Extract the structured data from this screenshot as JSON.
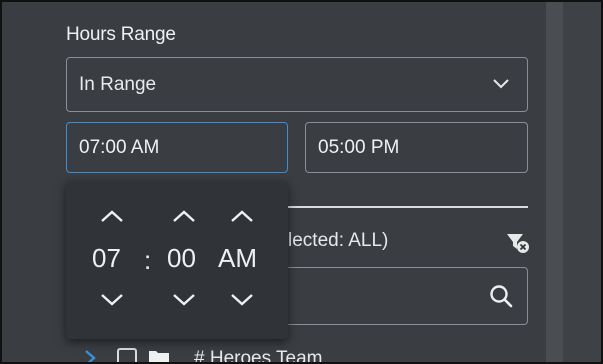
{
  "hours_range": {
    "label": "Hours Range",
    "mode_value": "In Range",
    "from_value": "07:00 AM",
    "to_value": "05:00 PM"
  },
  "time_picker": {
    "hour": "07",
    "separator": ":",
    "minute": "00",
    "meridiem": "AM"
  },
  "selection": {
    "partial_label": "lected: ALL)"
  },
  "tree": {
    "first_item": "# Heroes Team"
  },
  "icons": {
    "dropdown": "chevron-down-icon",
    "filter_clear": "filter-clear-icon",
    "search": "search-icon",
    "expand": "chevron-right-icon",
    "folder": "folder-icon"
  },
  "colors": {
    "focus_border": "#3a8fd6",
    "expand_chevron": "#3a8fd6"
  }
}
